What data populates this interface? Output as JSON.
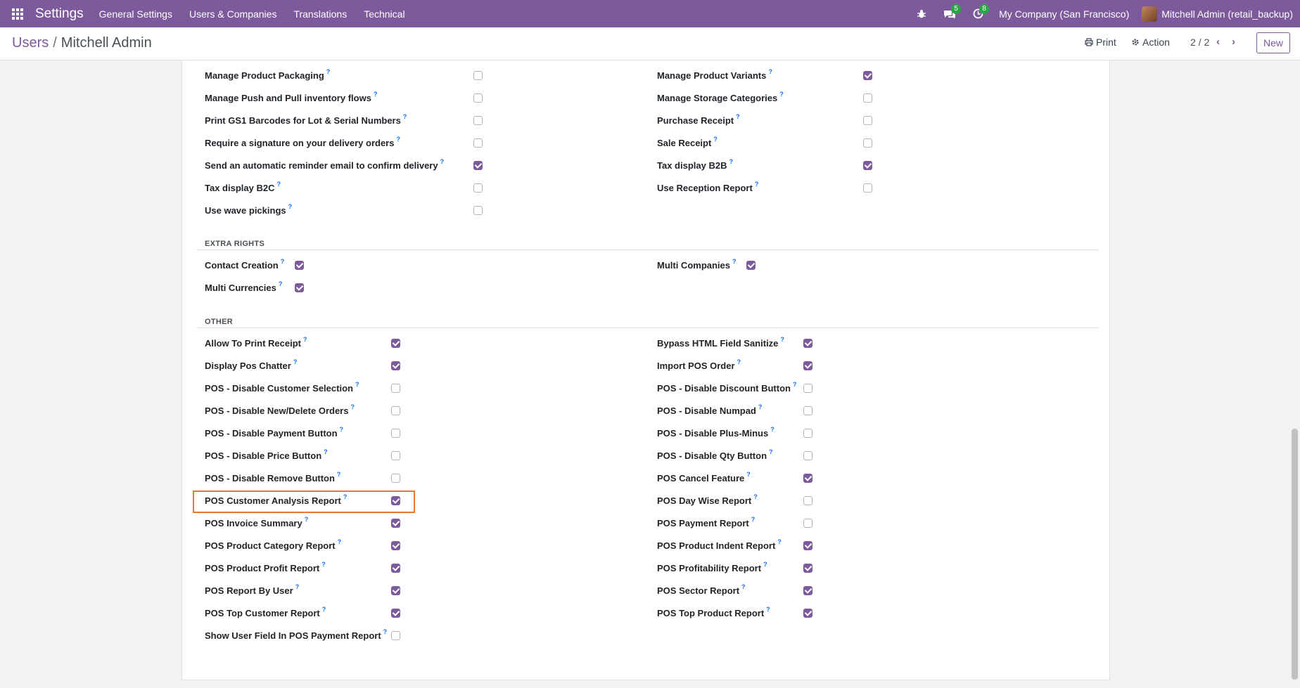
{
  "navbar": {
    "brand": "Settings",
    "menus": [
      "General Settings",
      "Users & Companies",
      "Translations",
      "Technical"
    ],
    "messages_badge": "5",
    "activities_badge": "8",
    "company": "My Company (San Francisco)",
    "user": "Mitchell Admin (retail_backup)"
  },
  "control_panel": {
    "breadcrumb_parent": "Users",
    "breadcrumb_current": "Mitchell Admin",
    "print_label": "Print",
    "action_label": "Action",
    "pager": "2 / 2",
    "new_label": "New"
  },
  "sections": {
    "inventory_left": [
      {
        "label": "Manage Product Packaging",
        "checked": false
      },
      {
        "label": "Manage Push and Pull inventory flows",
        "checked": false
      },
      {
        "label": "Print GS1 Barcodes for Lot & Serial Numbers",
        "checked": false
      },
      {
        "label": "Require a signature on your delivery orders",
        "checked": false
      },
      {
        "label": "Send an automatic reminder email to confirm delivery",
        "checked": true
      },
      {
        "label": "Tax display B2C",
        "checked": false
      },
      {
        "label": "Use wave pickings",
        "checked": false
      }
    ],
    "inventory_right": [
      {
        "label": "Manage Product Variants",
        "checked": true
      },
      {
        "label": "Manage Storage Categories",
        "checked": false
      },
      {
        "label": "Purchase Receipt",
        "checked": false
      },
      {
        "label": "Sale Receipt",
        "checked": false
      },
      {
        "label": "Tax display B2B",
        "checked": true
      },
      {
        "label": "Use Reception Report",
        "checked": false
      }
    ],
    "extra_rights_title": "EXTRA RIGHTS",
    "extra_left": [
      {
        "label": "Contact Creation",
        "checked": true
      },
      {
        "label": "Multi Currencies",
        "checked": true
      }
    ],
    "extra_right": [
      {
        "label": "Multi Companies",
        "checked": true
      }
    ],
    "other_title": "OTHER",
    "other_left": [
      {
        "label": "Allow To Print Receipt",
        "checked": true
      },
      {
        "label": "Display Pos Chatter",
        "checked": true
      },
      {
        "label": "POS - Disable Customer Selection",
        "checked": false
      },
      {
        "label": "POS - Disable New/Delete Orders",
        "checked": false
      },
      {
        "label": "POS - Disable Payment Button",
        "checked": false
      },
      {
        "label": "POS - Disable Price Button",
        "checked": false
      },
      {
        "label": "POS - Disable Remove Button",
        "checked": false
      },
      {
        "label": "POS Customer Analysis Report",
        "checked": true
      },
      {
        "label": "POS Invoice Summary",
        "checked": true
      },
      {
        "label": "POS Product Category Report",
        "checked": true
      },
      {
        "label": "POS Product Profit Report",
        "checked": true
      },
      {
        "label": "POS Report By User",
        "checked": true
      },
      {
        "label": "POS Top Customer Report",
        "checked": true
      },
      {
        "label": "Show User Field In POS Payment Report",
        "checked": false
      }
    ],
    "other_right": [
      {
        "label": "Bypass HTML Field Sanitize",
        "checked": true
      },
      {
        "label": "Import POS Order",
        "checked": true
      },
      {
        "label": "POS - Disable Discount Button",
        "checked": false
      },
      {
        "label": "POS - Disable Numpad",
        "checked": false
      },
      {
        "label": "POS - Disable Plus-Minus",
        "checked": false
      },
      {
        "label": "POS - Disable Qty Button",
        "checked": false
      },
      {
        "label": "POS Cancel Feature",
        "checked": true
      },
      {
        "label": "POS Day Wise Report",
        "checked": false
      },
      {
        "label": "POS Payment Report",
        "checked": false
      },
      {
        "label": "POS Product Indent Report",
        "checked": true
      },
      {
        "label": "POS Profitability Report",
        "checked": true
      },
      {
        "label": "POS Sector Report",
        "checked": true
      },
      {
        "label": "POS Top Product Report",
        "checked": true
      }
    ]
  },
  "help_mark": "?",
  "colors": {
    "navbar": "#7c5a9b",
    "accent": "#7c5a9b",
    "highlight": "#f0762a"
  }
}
